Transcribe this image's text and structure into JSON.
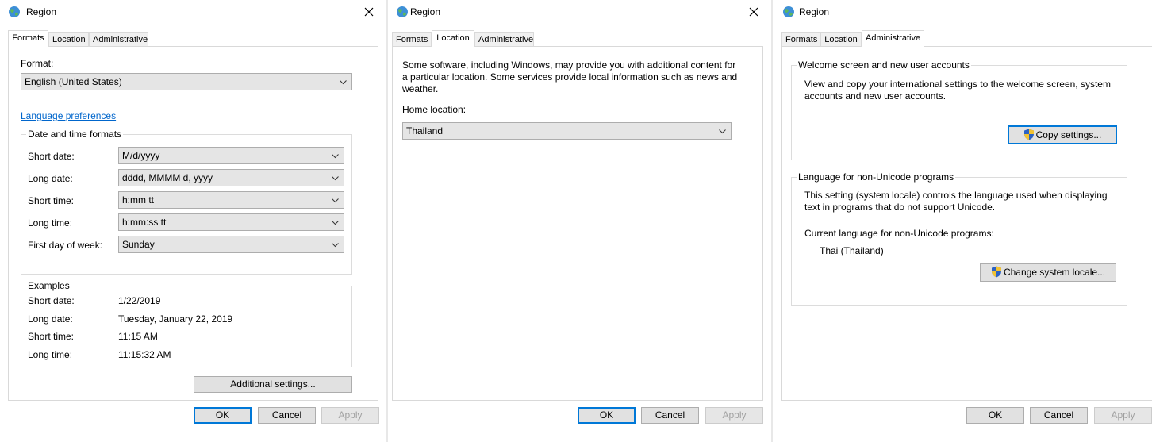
{
  "window_title": "Region",
  "tabs": [
    "Formats",
    "Location",
    "Administrative"
  ],
  "dialog_buttons": {
    "ok": "OK",
    "cancel": "Cancel",
    "apply": "Apply"
  },
  "formats": {
    "format_label": "Format:",
    "format_value": "English (United States)",
    "language_prefs_link": "Language preferences",
    "datetime_group_title": "Date and time formats",
    "fields": [
      {
        "label": "Short date:",
        "value": "M/d/yyyy"
      },
      {
        "label": "Long date:",
        "value": "dddd, MMMM d, yyyy"
      },
      {
        "label": "Short time:",
        "value": "h:mm tt"
      },
      {
        "label": "Long time:",
        "value": "h:mm:ss tt"
      },
      {
        "label": "First day of week:",
        "value": "Sunday"
      }
    ],
    "examples_group_title": "Examples",
    "examples": [
      {
        "label": "Short date:",
        "value": "1/22/2019"
      },
      {
        "label": "Long date:",
        "value": "Tuesday, January 22, 2019"
      },
      {
        "label": "Short time:",
        "value": "11:15 AM"
      },
      {
        "label": "Long time:",
        "value": "11:15:32 AM"
      }
    ],
    "additional_settings": "Additional settings..."
  },
  "location": {
    "description": "Some software, including Windows, may provide you with additional content for a particular location. Some services provide local information such as news and weather.",
    "home_label": "Home location:",
    "home_value": "Thailand"
  },
  "administrative": {
    "welcome_group_title": "Welcome screen and new user accounts",
    "welcome_desc": "View and copy your international settings to the welcome screen, system accounts and new user accounts.",
    "copy_button": "Copy settings...",
    "nonunicode_group_title": "Language for non-Unicode programs",
    "nonunicode_desc": "This setting (system locale) controls the language used when displaying text in programs that do not support Unicode.",
    "current_label": "Current language for non-Unicode programs:",
    "current_value": "Thai (Thailand)",
    "change_button": "Change system locale..."
  },
  "colors": {
    "accent": "#0078d7",
    "link": "#0066cc",
    "panel_border": "#d9d9d9"
  }
}
